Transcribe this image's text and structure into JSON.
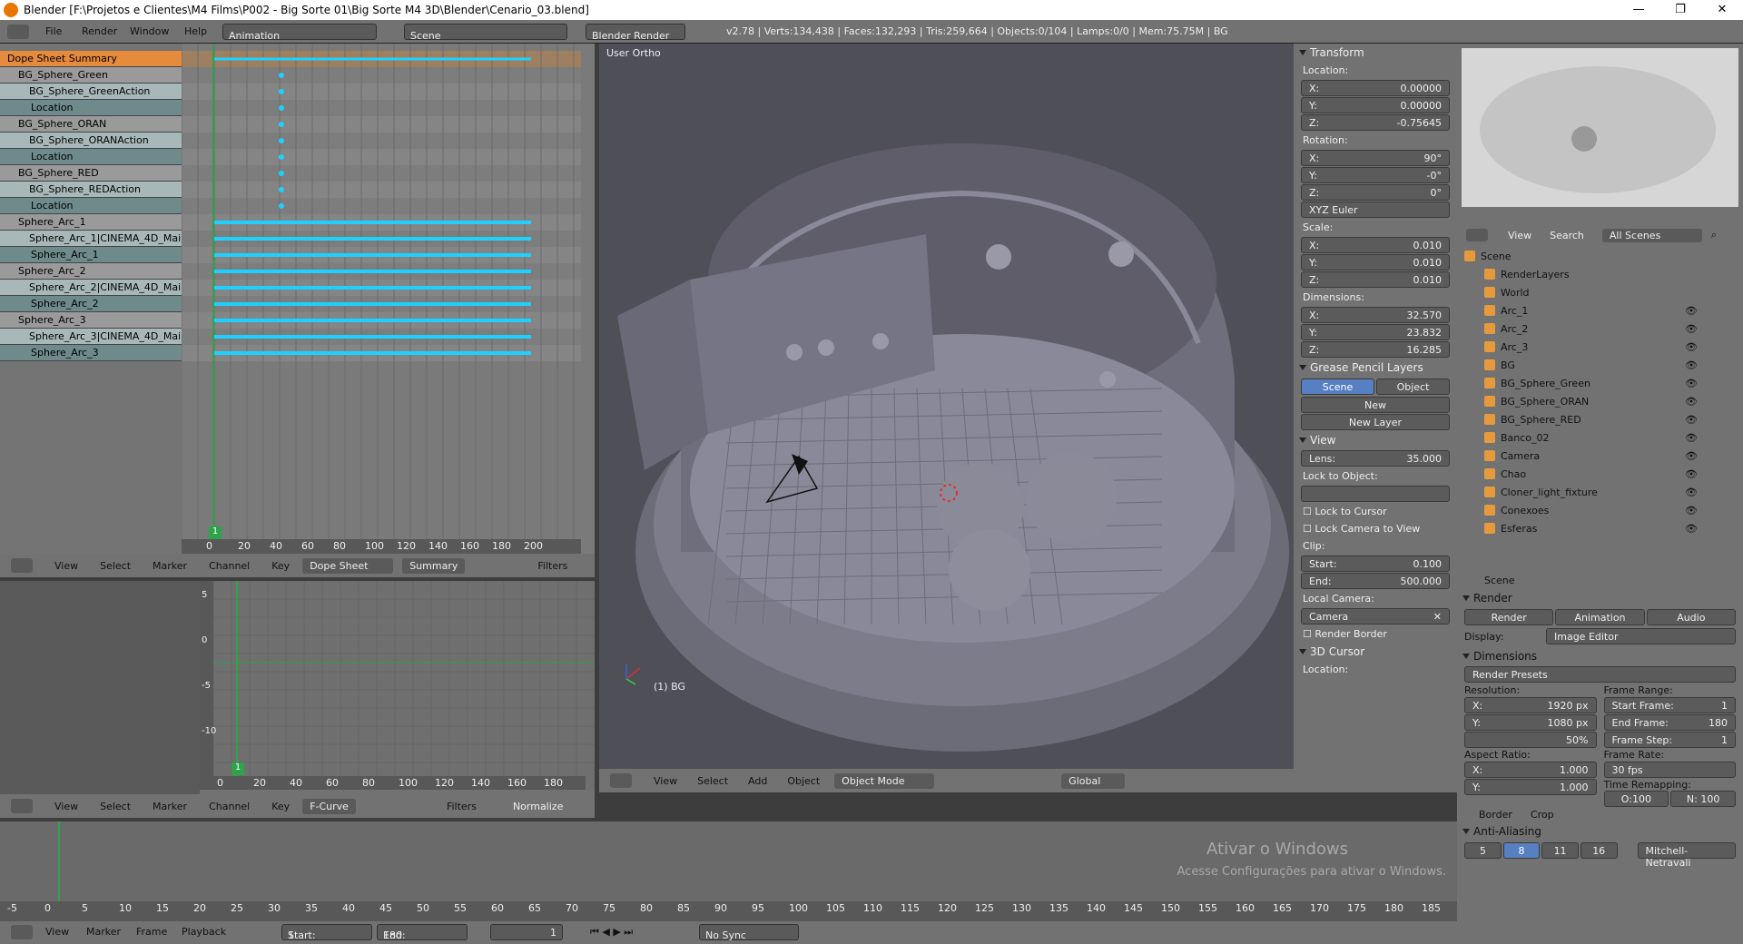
{
  "window": {
    "title": "Blender [F:\\Projetos e Clientes\\M4 Films\\P002 - Big Sorte 01\\Big Sorte M4 3D\\Blender\\Cenario_03.blend]"
  },
  "menubar": {
    "file": "File",
    "render": "Render",
    "window": "Window",
    "help": "Help",
    "layout": "Animation",
    "scene": "Scene",
    "engine": "Blender Render",
    "stats": "v2.78 | Verts:134,438 | Faces:132,293 | Tris:259,664 | Objects:0/104 | Lamps:0/0 | Mem:75.75M | BG"
  },
  "dopesheet": {
    "channels": [
      {
        "label": "Dope Sheet Summary",
        "kind": "sum"
      },
      {
        "label": "BG_Sphere_Green",
        "kind": "obj"
      },
      {
        "label": "BG_Sphere_GreenAction",
        "kind": "act"
      },
      {
        "label": "Location",
        "kind": "grp"
      },
      {
        "label": "BG_Sphere_ORAN",
        "kind": "obj"
      },
      {
        "label": "BG_Sphere_ORANAction",
        "kind": "act"
      },
      {
        "label": "Location",
        "kind": "grp"
      },
      {
        "label": "BG_Sphere_RED",
        "kind": "obj"
      },
      {
        "label": "BG_Sphere_REDAction",
        "kind": "act"
      },
      {
        "label": "Location",
        "kind": "grp"
      },
      {
        "label": "Sphere_Arc_1",
        "kind": "obj"
      },
      {
        "label": "Sphere_Arc_1|CINEMA_4D_Mai",
        "kind": "act"
      },
      {
        "label": "Sphere_Arc_1",
        "kind": "grp"
      },
      {
        "label": "Sphere_Arc_2",
        "kind": "obj"
      },
      {
        "label": "Sphere_Arc_2|CINEMA_4D_Mai",
        "kind": "act"
      },
      {
        "label": "Sphere_Arc_2",
        "kind": "grp"
      },
      {
        "label": "Sphere_Arc_3",
        "kind": "obj"
      },
      {
        "label": "Sphere_Arc_3|CINEMA_4D_Mai",
        "kind": "act"
      },
      {
        "label": "Sphere_Arc_3",
        "kind": "grp"
      }
    ],
    "ruler": [
      "0",
      "20",
      "40",
      "60",
      "80",
      "100",
      "120",
      "140",
      "160",
      "180",
      "200"
    ],
    "current_frame": "1",
    "header": {
      "view": "View",
      "select": "Select",
      "marker": "Marker",
      "channel": "Channel",
      "key": "Key",
      "mode": "Dope Sheet",
      "summary": "Summary",
      "filters": "Filters"
    }
  },
  "graph": {
    "ruler": [
      "0",
      "20",
      "40",
      "60",
      "80",
      "100",
      "120",
      "140",
      "160",
      "180"
    ],
    "yticks": [
      "5",
      "0",
      "-5",
      "-10"
    ],
    "current_frame": "1",
    "header": {
      "view": "View",
      "select": "Select",
      "marker": "Marker",
      "channel": "Channel",
      "key": "Key",
      "mode": "F-Curve",
      "filters": "Filters",
      "normalize": "Normalize"
    }
  },
  "viewport": {
    "label": "User Ortho",
    "object": "(1) BG",
    "header": {
      "view": "View",
      "select": "Select",
      "add": "Add",
      "object": "Object",
      "mode": "Object Mode",
      "orient": "Global"
    }
  },
  "npanel": {
    "transform": "Transform",
    "location_label": "Location:",
    "location": [
      {
        "axis": "X:",
        "val": "0.00000"
      },
      {
        "axis": "Y:",
        "val": "0.00000"
      },
      {
        "axis": "Z:",
        "val": "-0.75645"
      }
    ],
    "rotation_label": "Rotation:",
    "rotation": [
      {
        "axis": "X:",
        "val": "90°"
      },
      {
        "axis": "Y:",
        "val": "-0°"
      },
      {
        "axis": "Z:",
        "val": "0°"
      }
    ],
    "rot_mode": "XYZ Euler",
    "scale_label": "Scale:",
    "scale": [
      {
        "axis": "X:",
        "val": "0.010"
      },
      {
        "axis": "Y:",
        "val": "0.010"
      },
      {
        "axis": "Z:",
        "val": "0.010"
      }
    ],
    "dims_label": "Dimensions:",
    "dims": [
      {
        "axis": "X:",
        "val": "32.570"
      },
      {
        "axis": "Y:",
        "val": "23.832"
      },
      {
        "axis": "Z:",
        "val": "16.285"
      }
    ],
    "gp": "Grease Pencil Layers",
    "gp_scene": "Scene",
    "gp_object": "Object",
    "gp_new": "New",
    "gp_newlayer": "New Layer",
    "view": "View",
    "lens_label": "Lens:",
    "lens": "35.000",
    "lock_obj": "Lock to Object:",
    "lock_cursor": "Lock to Cursor",
    "lock_camera": "Lock Camera to View",
    "clip": "Clip:",
    "clip_start_label": "Start:",
    "clip_start": "0.100",
    "clip_end_label": "End:",
    "clip_end": "500.000",
    "local_cam": "Local Camera:",
    "camera": "Camera",
    "render_border": "Render Border",
    "cursor": "3D Cursor",
    "cursor_loc": "Location:"
  },
  "outliner": {
    "header": {
      "view": "View",
      "search": "Search",
      "scenes": "All Scenes"
    },
    "items": [
      {
        "label": "Scene",
        "indent": 0
      },
      {
        "label": "RenderLayers",
        "indent": 1
      },
      {
        "label": "World",
        "indent": 1
      },
      {
        "label": "Arc_1",
        "indent": 1
      },
      {
        "label": "Arc_2",
        "indent": 1
      },
      {
        "label": "Arc_3",
        "indent": 1
      },
      {
        "label": "BG",
        "indent": 1
      },
      {
        "label": "BG_Sphere_Green",
        "indent": 1
      },
      {
        "label": "BG_Sphere_ORAN",
        "indent": 1
      },
      {
        "label": "BG_Sphere_RED",
        "indent": 1
      },
      {
        "label": "Banco_02",
        "indent": 1
      },
      {
        "label": "Camera",
        "indent": 1
      },
      {
        "label": "Chao",
        "indent": 1
      },
      {
        "label": "Cloner_light_fixture",
        "indent": 1
      },
      {
        "label": "Conexoes",
        "indent": 1
      },
      {
        "label": "Esferas",
        "indent": 1
      }
    ]
  },
  "properties": {
    "context": "Scene",
    "render": "Render",
    "btn_render": "Render",
    "btn_anim": "Animation",
    "btn_audio": "Audio",
    "display_label": "Display:",
    "display": "Image Editor",
    "dimensions": "Dimensions",
    "presets": "Render Presets",
    "resolution": "Resolution:",
    "res_x_label": "X:",
    "res_x": "1920 px",
    "res_y_label": "Y:",
    "res_y": "1080 px",
    "res_pct": "50%",
    "frame_range": "Frame Range:",
    "start_label": "Start Frame:",
    "start": "1",
    "end_label": "End Frame:",
    "end": "180",
    "step_label": "Frame Step:",
    "step": "1",
    "aspect": "Aspect Ratio:",
    "asp_x_label": "X:",
    "asp_x": "1.000",
    "asp_y_label": "Y:",
    "asp_y": "1.000",
    "frame_rate": "Frame Rate:",
    "fps": "30 fps",
    "remap": "Time Remapping:",
    "old": "O:100",
    "new": "N: 100",
    "border": "Border",
    "crop": "Crop",
    "aa": "Anti-Aliasing",
    "aa_vals": [
      "5",
      "8",
      "11",
      "16"
    ],
    "aa_filter": "Mitchell-Netravali"
  },
  "timeline": {
    "ticks": [
      "-5",
      "0",
      "5",
      "10",
      "15",
      "20",
      "25",
      "30",
      "35",
      "40",
      "45",
      "50",
      "55",
      "60",
      "65",
      "70",
      "75",
      "80",
      "85",
      "90",
      "95",
      "100",
      "105",
      "110",
      "115",
      "120",
      "125",
      "130",
      "135",
      "140",
      "145",
      "150",
      "155",
      "160",
      "165",
      "170",
      "175",
      "180",
      "185"
    ],
    "header": {
      "view": "View",
      "marker": "Marker",
      "frame": "Frame",
      "playback": "Playback",
      "start_label": "Start:",
      "start": "1",
      "end_label": "End:",
      "end": "180",
      "current": "1",
      "sync": "No Sync"
    }
  },
  "watermark": {
    "line1": "Ativar o Windows",
    "line2": "Acesse Configurações para ativar o Windows."
  },
  "colors": {
    "accent": "#e68a3c",
    "key": "#1fd0ff",
    "blue": "#5680c2"
  }
}
